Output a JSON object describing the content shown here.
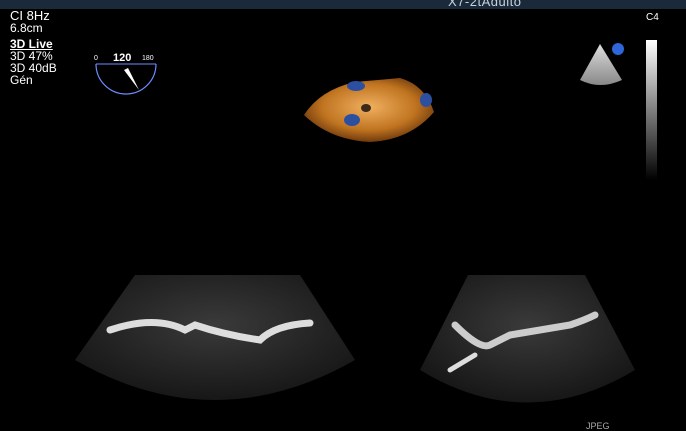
{
  "header": {
    "title": "X7-2tAdulto"
  },
  "settings": {
    "line1": "CI 8Hz",
    "line2": "6.8cm",
    "mode": "3D Live",
    "line4": "3D 47%",
    "line5": "3D 40dB",
    "line6": "Gén"
  },
  "probe_angle": {
    "min": "0",
    "value": "120",
    "max": "180"
  },
  "corner_label": "C4",
  "footer": {
    "text": "JPEG"
  }
}
